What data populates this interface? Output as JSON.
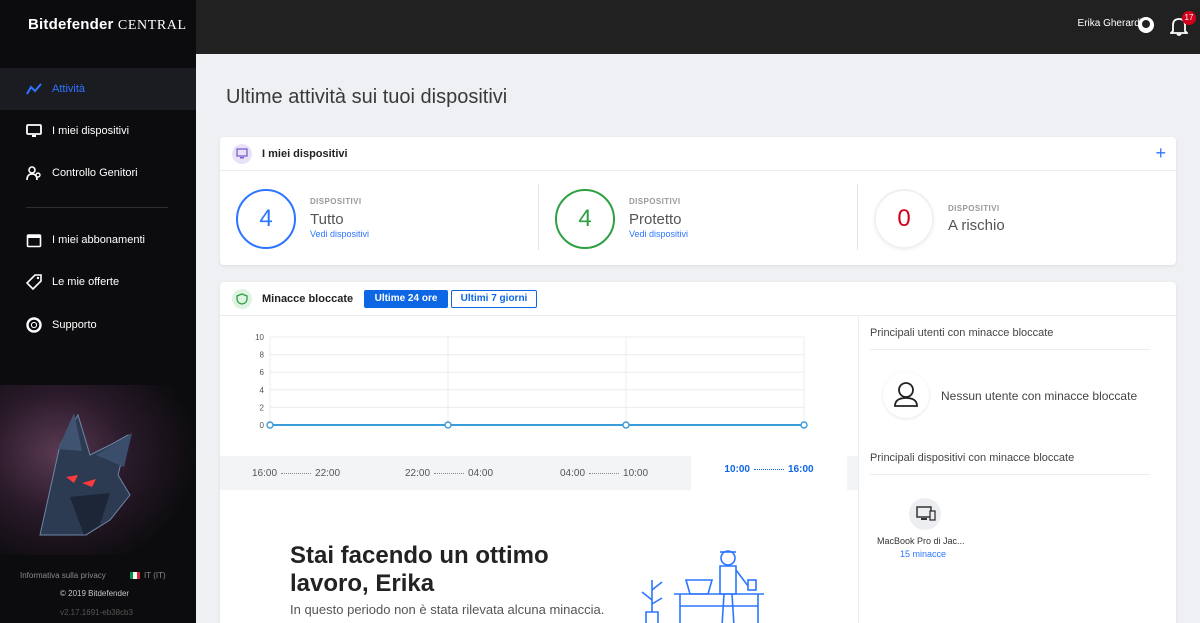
{
  "brand": {
    "name": "Bitdefender",
    "product": "CENTRAL"
  },
  "sidebar": {
    "items": [
      {
        "label": "Attività",
        "icon": "activity-icon",
        "active": true
      },
      {
        "label": "I miei dispositivi",
        "icon": "monitor-icon"
      },
      {
        "label": "Controllo Genitori",
        "icon": "parental-icon"
      },
      {
        "label": "I miei abbonamenti",
        "icon": "calendar-icon"
      },
      {
        "label": "Le mie offerte",
        "icon": "tag-icon"
      },
      {
        "label": "Supporto",
        "icon": "lifebuoy-icon"
      }
    ],
    "footer": {
      "privacy": "Informativa sulla privacy",
      "lang": "IT (IT)",
      "copyright": "© 2019 Bitdefender",
      "version": "v2.17.1691-eb38cb3"
    }
  },
  "topbar": {
    "user_name": "Erika Gherardi",
    "notifications": "17"
  },
  "page_title": "Ultime attività sui tuoi dispositivi",
  "devices_card": {
    "title": "I miei dispositivi",
    "add": "+",
    "stats": [
      {
        "label": "DISPOSITIVI",
        "value": "4",
        "name": "Tutto",
        "link": "Vedi dispositivi",
        "color": "#2c76ff"
      },
      {
        "label": "DISPOSITIVI",
        "value": "4",
        "name": "Protetto",
        "link": "Vedi dispositivi",
        "color": "#2ea043"
      },
      {
        "label": "DISPOSITIVI",
        "value": "0",
        "name": "A rischio",
        "link": "",
        "color": "#d0021b"
      }
    ]
  },
  "threats_card": {
    "title": "Minacce bloccate",
    "tabs": [
      "Ultime 24 ore",
      "Ultimi 7 giorni"
    ],
    "timeline": [
      {
        "from": "16:00",
        "to": "22:00"
      },
      {
        "from": "22:00",
        "to": "04:00"
      },
      {
        "from": "04:00",
        "to": "10:00"
      },
      {
        "from": "10:00",
        "to": "16:00",
        "selected": true
      }
    ],
    "hero_title": "Stai facendo un ottimo lavoro, Erika",
    "hero_subtitle": "In questo periodo non è stata rilevata alcuna minaccia.",
    "top_users_title": "Principali utenti con minacce bloccate",
    "no_users": "Nessun utente con minacce bloccate",
    "top_devices_title": "Principali dispositivi con minacce bloccate",
    "device_name": "MacBook Pro di Jac...",
    "device_threats": "15 minacce"
  },
  "chart_data": {
    "type": "line",
    "x": [
      "16:00",
      "22:00",
      "04:00",
      "10:00"
    ],
    "series": [
      {
        "values": [
          0,
          0,
          0,
          0
        ]
      }
    ],
    "yticks": [
      0,
      2,
      4,
      6,
      8,
      10
    ],
    "ylim": [
      0,
      10
    ],
    "grid": true,
    "color": "#3a9bd9"
  }
}
